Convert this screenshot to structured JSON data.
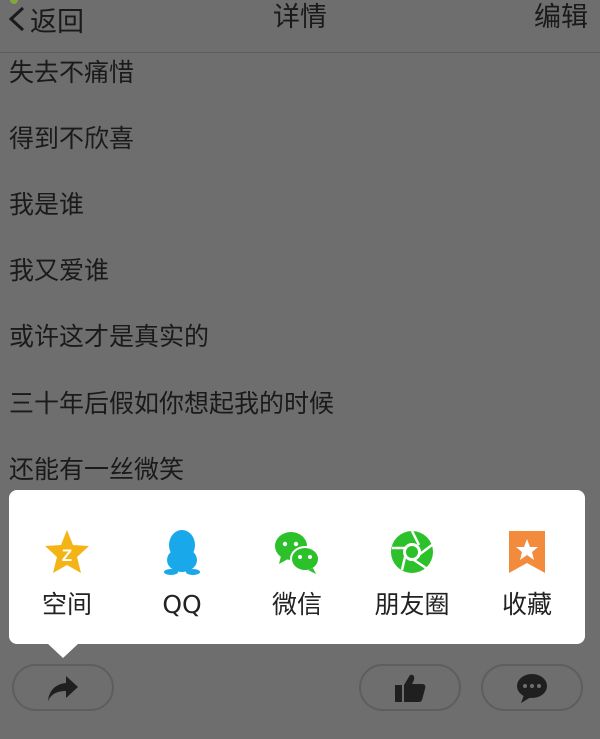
{
  "header": {
    "back_label": "返回",
    "title": "详情",
    "edit_label": "编辑"
  },
  "content": {
    "lines": [
      "失去不痛惜",
      "得到不欣喜",
      "我是谁",
      "我又爱谁",
      "或许这才是真实的",
      "三十年后假如你想起我的时候",
      "还能有一丝微笑"
    ]
  },
  "share_sheet": {
    "items": [
      {
        "label": "空间",
        "icon": "qzone-star-icon",
        "color": "#f5b416"
      },
      {
        "label": "QQ",
        "icon": "qq-penguin-icon",
        "color": "#19a9ea"
      },
      {
        "label": "微信",
        "icon": "wechat-icon",
        "color": "#2cc02a"
      },
      {
        "label": "朋友圈",
        "icon": "moments-aperture-icon",
        "color": "#2cc02a"
      },
      {
        "label": "收藏",
        "icon": "bookmark-star-icon",
        "color": "#f28c3c"
      }
    ]
  },
  "bottom_bar": {
    "share_icon": "share-arrow-icon",
    "like_icon": "thumbs-up-icon",
    "comment_icon": "comment-bubble-icon"
  }
}
